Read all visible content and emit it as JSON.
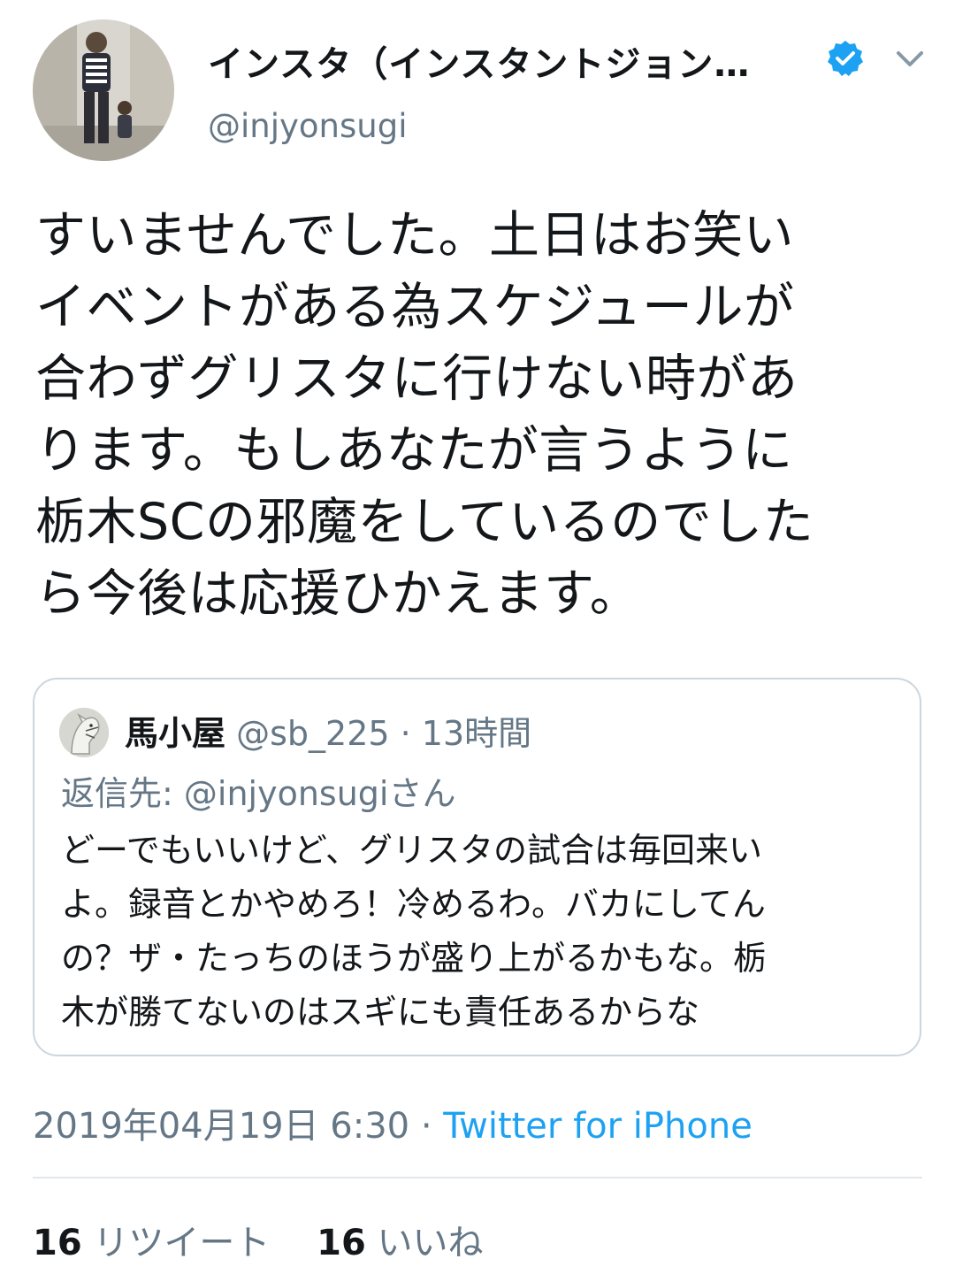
{
  "user": {
    "display_name": "インスタ（インスタントジョン…",
    "handle": "@injyonsugi",
    "verified_icon": "verified-badge-icon",
    "menu_icon": "chevron-down-icon"
  },
  "tweet": {
    "lines": [
      "すいませんでした。土日はお笑い",
      "イベントがある為スケジュールが",
      "合わずグリスタに行けない時があ",
      "ります。もしあなたが言うように",
      "栃木SCの邪魔をしているのでした",
      "ら今後は応援ひかえます。"
    ]
  },
  "quote": {
    "name": "馬小屋",
    "meta": "@sb_225 · 13時間",
    "reply_prefix": "返信先: ",
    "reply_mention": "@injyonsugiさん",
    "lines": [
      "どーでもいいけど、グリスタの試合は毎回来い",
      "よ。録音とかやめろ！冷めるわ。バカにしてん",
      "の？ザ・たっちのほうが盛り上がるかもな。栃",
      "木が勝てないのはスギにも責任あるからな"
    ]
  },
  "meta": {
    "timestamp": "2019年04月19日 6:30",
    "separator": "·",
    "source": "Twitter for iPhone"
  },
  "stats": {
    "retweets_count": "16",
    "retweets_label": "リツイート",
    "likes_count": "16",
    "likes_label": "いいね"
  },
  "colors": {
    "primary_text": "#14171a",
    "secondary_text": "#657786",
    "link": "#1da1f2",
    "border": "#ccd6dd"
  }
}
